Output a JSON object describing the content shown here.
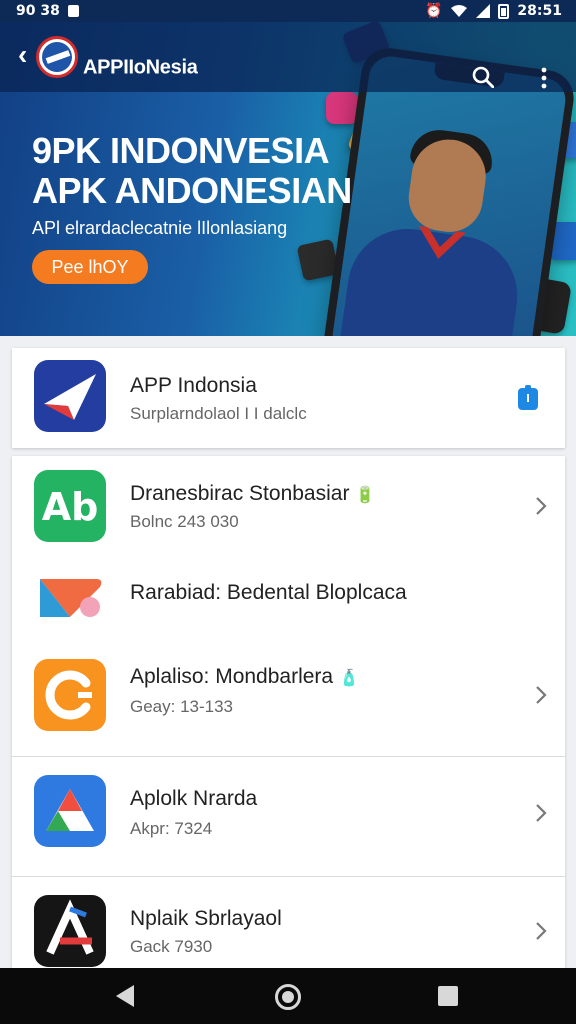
{
  "status_bar": {
    "left_text": "90 38",
    "time": "28:51"
  },
  "header": {
    "title": "APPIIoNesia",
    "icons": [
      "back-icon",
      "app-logo",
      "search-icon",
      "more-icon"
    ]
  },
  "hero": {
    "title_line1": "9PK INDONVESIA",
    "title_line2": "APK ANDONESIAN",
    "subtitle": "APl elrardaclecatnie lIlonlasiang",
    "button_label": "Pee lhOY"
  },
  "featured": {
    "title": "APP Indonsia",
    "subtitle": "Surplarndolaol I I dalclc",
    "icon": "paper-plane-icon",
    "badge_icon": "download-badge-icon",
    "badge_color": "#1e88e5"
  },
  "apps": [
    {
      "title": "Dranesbirac Stonbasiar",
      "subtitle": "Bolnc 243 030",
      "icon": "ab-letter-icon",
      "color": "#23b363",
      "badge": "🔋",
      "has_chevron": true
    },
    {
      "title": "Rarabiad: Bedental Bloplcaca",
      "subtitle": "",
      "icon": "swirl-play-icon",
      "color": "#f06a42",
      "badge": "",
      "has_chevron": false
    },
    {
      "title": "Aplaliso: Mondbarlera",
      "subtitle": "Geay: 13-133",
      "icon": "c-arrow-icon",
      "color": "#f7931e",
      "badge": "🧴",
      "has_chevron": true
    },
    {
      "title": "Aplolk Nrarda",
      "subtitle": "Akpr: 7324",
      "icon": "triangle-icon",
      "color": "#2f7ae0",
      "badge": "",
      "has_chevron": true
    },
    {
      "title": "Nplaik Sbrlayaol",
      "subtitle": "Gack 7930",
      "icon": "a-logo-icon",
      "color": "#151515",
      "badge": "",
      "has_chevron": true
    }
  ],
  "nav": {
    "icons": [
      "nav-back-icon",
      "nav-home-icon",
      "nav-recent-icon"
    ]
  },
  "colors": {
    "header_bg": "#0d2a56",
    "accent_button": "#f47b20",
    "hero_gradient_start": "#123f84",
    "hero_gradient_end": "#2ac0c2"
  }
}
